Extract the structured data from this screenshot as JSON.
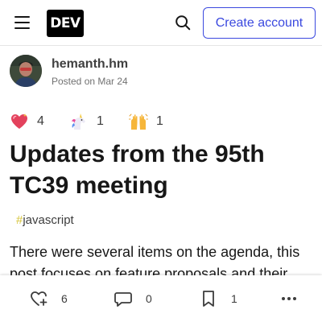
{
  "header": {
    "menu_icon": "hamburger-icon",
    "logo_text": "DEV",
    "search_icon": "search-icon",
    "create_account_label": "Create account"
  },
  "author": {
    "name": "hemanth.hm",
    "posted": "Posted on Mar 24"
  },
  "reactions": [
    {
      "icon": "heart-sparkle-icon",
      "count": "4"
    },
    {
      "icon": "unicorn-icon",
      "count": "1"
    },
    {
      "icon": "raised-hands-icon",
      "count": "1"
    }
  ],
  "post": {
    "title": "Updates from the 95th TC39 meeting",
    "tag_hash": "#",
    "tag": "javascript",
    "body": "There were several items on the agenda, this post focuses on feature proposals and their"
  },
  "bottom_bar": {
    "likes": "6",
    "comments": "0",
    "bookmarks": "1",
    "more_icon": "more-horizontal-icon"
  },
  "colors": {
    "accent": "#3b49df",
    "tag_hash": "#d6c53a"
  }
}
